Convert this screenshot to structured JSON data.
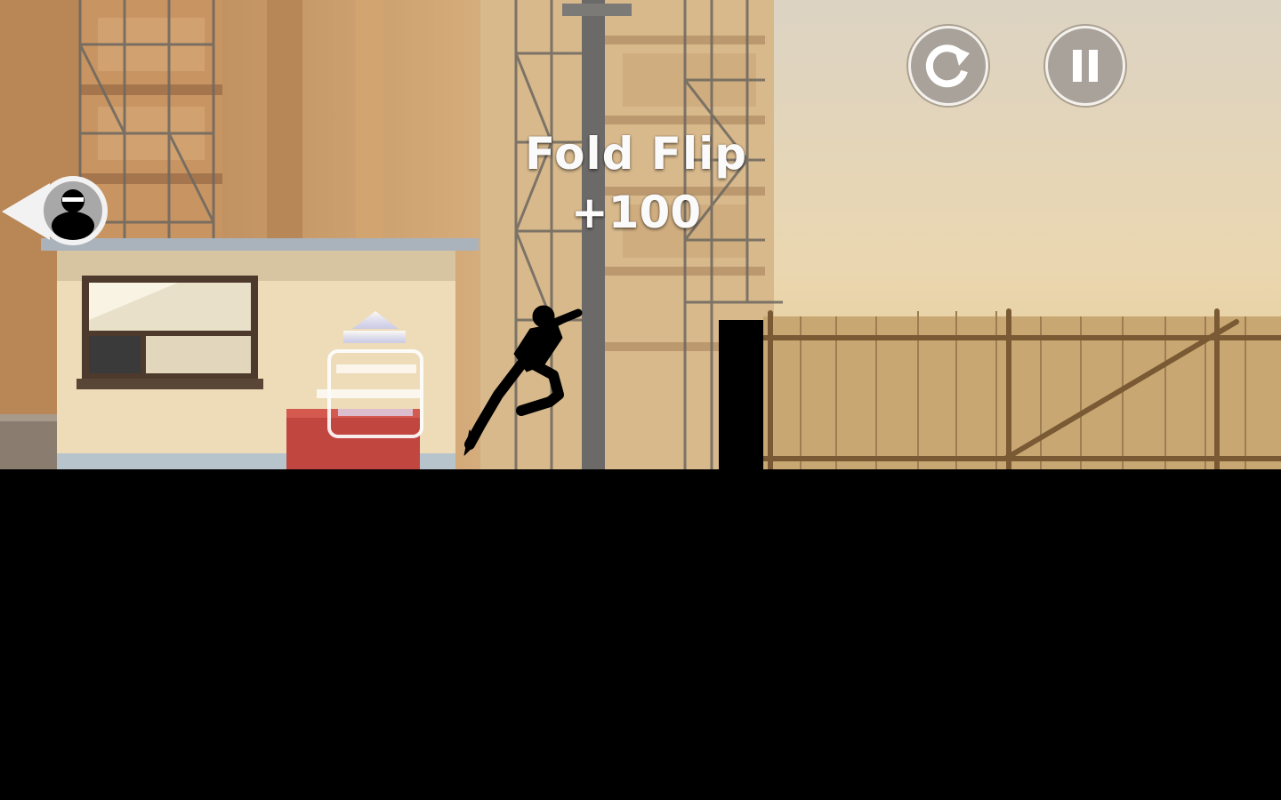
{
  "trick_popup": {
    "name": "Fold Flip",
    "points": "+100"
  },
  "hud": {
    "restart_icon": "restart-icon",
    "pause_icon": "pause-icon",
    "button_fill": "#a8a29a",
    "button_border": "#f4f1ec"
  },
  "chaser_indicator": {
    "icon": "hunter-silhouette-icon",
    "direction": "left"
  },
  "colors": {
    "sky": "#e9d7b4",
    "ground": "#000000",
    "fence": "#c9a772",
    "building": "#c89a64",
    "cabin_wall": "#eedbb8",
    "crate": "#c0463f"
  }
}
